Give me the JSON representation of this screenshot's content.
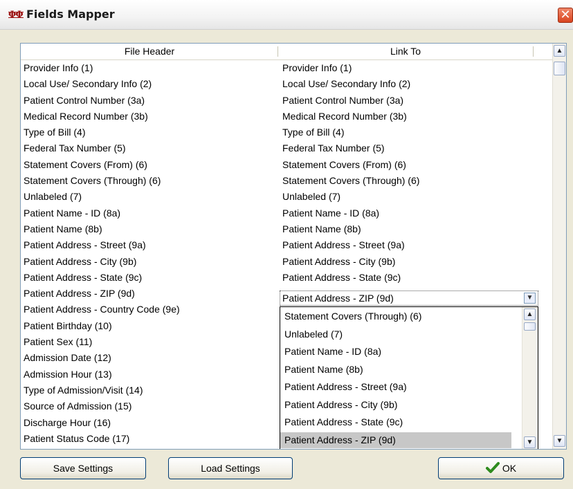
{
  "window": {
    "title": "Fields Mapper",
    "close_glyph": "✕"
  },
  "grid": {
    "columns": [
      "File Header",
      "Link To"
    ],
    "rows": [
      [
        "Provider Info (1)",
        "Provider Info (1)"
      ],
      [
        "Local Use/ Secondary Info (2)",
        "Local Use/ Secondary Info (2)"
      ],
      [
        "Patient Control Number (3a)",
        "Patient Control Number (3a)"
      ],
      [
        "Medical Record Number (3b)",
        "Medical Record Number (3b)"
      ],
      [
        "Type of Bill (4)",
        "Type of Bill (4)"
      ],
      [
        "Federal Tax Number (5)",
        "Federal Tax Number (5)"
      ],
      [
        "Statement Covers (From) (6)",
        "Statement Covers (From) (6)"
      ],
      [
        "Statement Covers (Through) (6)",
        "Statement Covers (Through) (6)"
      ],
      [
        "Unlabeled (7)",
        "Unlabeled (7)"
      ],
      [
        "Patient Name - ID (8a)",
        "Patient Name - ID (8a)"
      ],
      [
        "Patient Name (8b)",
        "Patient Name (8b)"
      ],
      [
        "Patient Address - Street (9a)",
        "Patient Address - Street (9a)"
      ],
      [
        "Patient Address - City (9b)",
        "Patient Address - City (9b)"
      ],
      [
        "Patient Address - State (9c)",
        "Patient Address - State (9c)"
      ],
      [
        "Patient Address - ZIP (9d)",
        ""
      ],
      [
        "Patient Address - Country Code (9e)",
        ""
      ],
      [
        "Patient Birthday (10)",
        ""
      ],
      [
        "Patient Sex (11)",
        ""
      ],
      [
        "Admission Date (12)",
        ""
      ],
      [
        "Admission Hour (13)",
        ""
      ],
      [
        "Type of Admission/Visit (14)",
        ""
      ],
      [
        "Source of Admission (15)",
        ""
      ],
      [
        "Discharge Hour (16)",
        ""
      ],
      [
        "Patient Status Code (17)",
        ""
      ]
    ]
  },
  "combo": {
    "value": "Patient Address - ZIP (9d)",
    "options": [
      "Statement Covers (Through) (6)",
      "Unlabeled (7)",
      "Patient Name - ID (8a)",
      "Patient Name (8b)",
      "Patient Address - Street (9a)",
      "Patient Address - City (9b)",
      "Patient Address - State (9c)",
      "Patient Address - ZIP (9d)"
    ],
    "selected_index": 7
  },
  "buttons": {
    "save": "Save Settings",
    "load": "Load Settings",
    "ok": "OK"
  },
  "colors": {
    "selection": "#c7c7c7",
    "ok_check": "#2e8b1e",
    "close": "#d9441f"
  },
  "icons": {
    "close": "close-icon",
    "ok": "check-icon",
    "scroll_up": "scroll-up-icon",
    "scroll_down": "scroll-down-icon",
    "dropdown": "chevron-down-icon"
  }
}
